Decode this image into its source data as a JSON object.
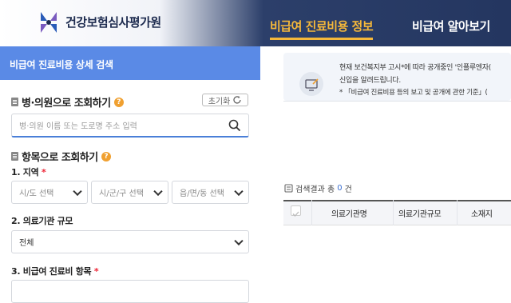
{
  "header": {
    "brand": "건강보험심사평가원",
    "nav": [
      "비급여 진료비용 정보",
      "비급여 알아보기"
    ]
  },
  "panel": {
    "title": "비급여 진료비용 상세 검색",
    "hospital_section": "병·의원으로 조회하기",
    "reset_label": "초기화",
    "search_placeholder": "병·의원 이름 또는 도로명 주소 입력",
    "item_section": "항목으로 조회하기",
    "region_label": "1. 지역",
    "region_selects": [
      "시/도 선택",
      "시/군/구 선택",
      "읍/면/동 선택"
    ],
    "scale_label": "2. 의료기관 규모",
    "scale_value": "전체",
    "item_label": "3. 비급여 진료비 항목",
    "required_mark": "*"
  },
  "notice": {
    "lines": [
      "현재 보건복지부 고시*에 따라 공개중인 '인플루엔자(",
      "신입을 알려드립니다.",
      "* 「비급여 진료비용 등의 보고 및 공개에 관한 기준」("
    ]
  },
  "results": {
    "prefix": "검색결과 총",
    "count": "0",
    "suffix": "건",
    "columns": [
      "의료기관명",
      "의료기관규모",
      "소재지"
    ]
  },
  "colors": {
    "accent": "#5a8ae6",
    "nav_active": "#f5b83a",
    "header_dark": "#243660",
    "help": "#f0a030"
  }
}
